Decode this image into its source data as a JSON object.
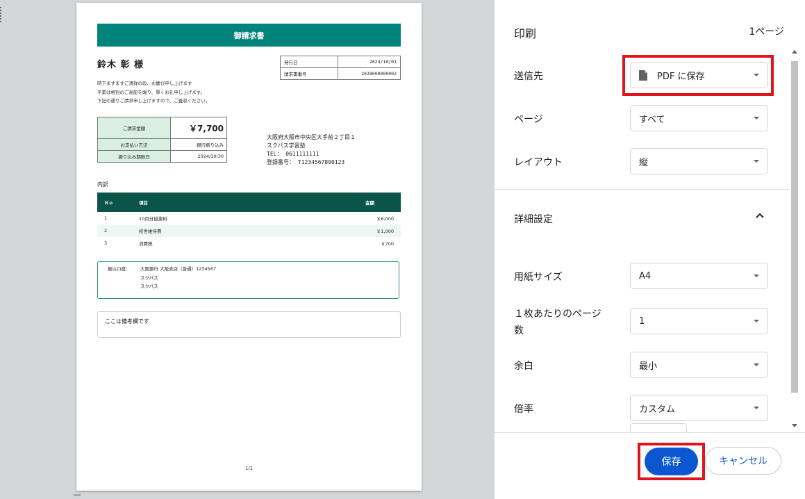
{
  "invoice": {
    "title": "御請求書",
    "customer": "鈴木 彰 様",
    "greeting": [
      "時下ますますご清祥の段、お慶び申し上げます",
      "平素は格別のご高配を賜り、厚くお礼申し上げます。",
      "下記の通りご請求申し上げますので、ご査収ください。"
    ],
    "meta": [
      {
        "label": "発行日",
        "value": "2024/10/01"
      },
      {
        "label": "請求書番号",
        "value": "2028000000002"
      }
    ],
    "amounts": [
      {
        "label": "ご請求金額",
        "value": "￥7,700"
      },
      {
        "label": "お支払い方法",
        "value": "銀行振り込み"
      },
      {
        "label": "振り込み期限日",
        "value": "2024/10/30"
      }
    ],
    "address": [
      "大阪府大阪市中央区大手前２丁目１",
      "スクパス学習塾",
      "TEL： 0611111111",
      "登録番号： T1234567890123"
    ],
    "breakdown_label": "内訳",
    "items_headers": [
      "Ｎｏ",
      "項目",
      "金額"
    ],
    "items": [
      {
        "no": "1",
        "name": "10月分授業料",
        "amount": "￥6,000"
      },
      {
        "no": "2",
        "name": "校舎維持費",
        "amount": "￥1,000"
      },
      {
        "no": "3",
        "name": "消費税",
        "amount": "￥700"
      }
    ],
    "bank_label": "振込口座：",
    "bank_lines": [
      "大阪銀行 大阪支店（普通）1234567",
      "スクパス",
      "スクパス"
    ],
    "note": "ここは備考欄です",
    "page_number": "1/1"
  },
  "settings": {
    "title": "印刷",
    "page_count": "1ページ",
    "destination_label": "送信先",
    "destination_value": "PDF に保存",
    "pages_label": "ページ",
    "pages_value": "すべて",
    "layout_label": "レイアウト",
    "layout_value": "縦",
    "advanced_label": "詳細設定",
    "paper_label": "用紙サイズ",
    "paper_value": "A4",
    "pages_per_sheet_label_1": "１枚あたりのページ",
    "pages_per_sheet_label_2": "数",
    "pages_per_sheet_value": "1",
    "margin_label": "余白",
    "margin_value": "最小",
    "scale_label": "倍率",
    "scale_value": "カスタム",
    "save_button": "保存",
    "cancel_button": "キャンセル"
  },
  "colors": {
    "accent_teal": "#00837b",
    "table_header": "#0a5449",
    "primary_button": "#0b57d0",
    "highlight_red": "#e0141e"
  }
}
